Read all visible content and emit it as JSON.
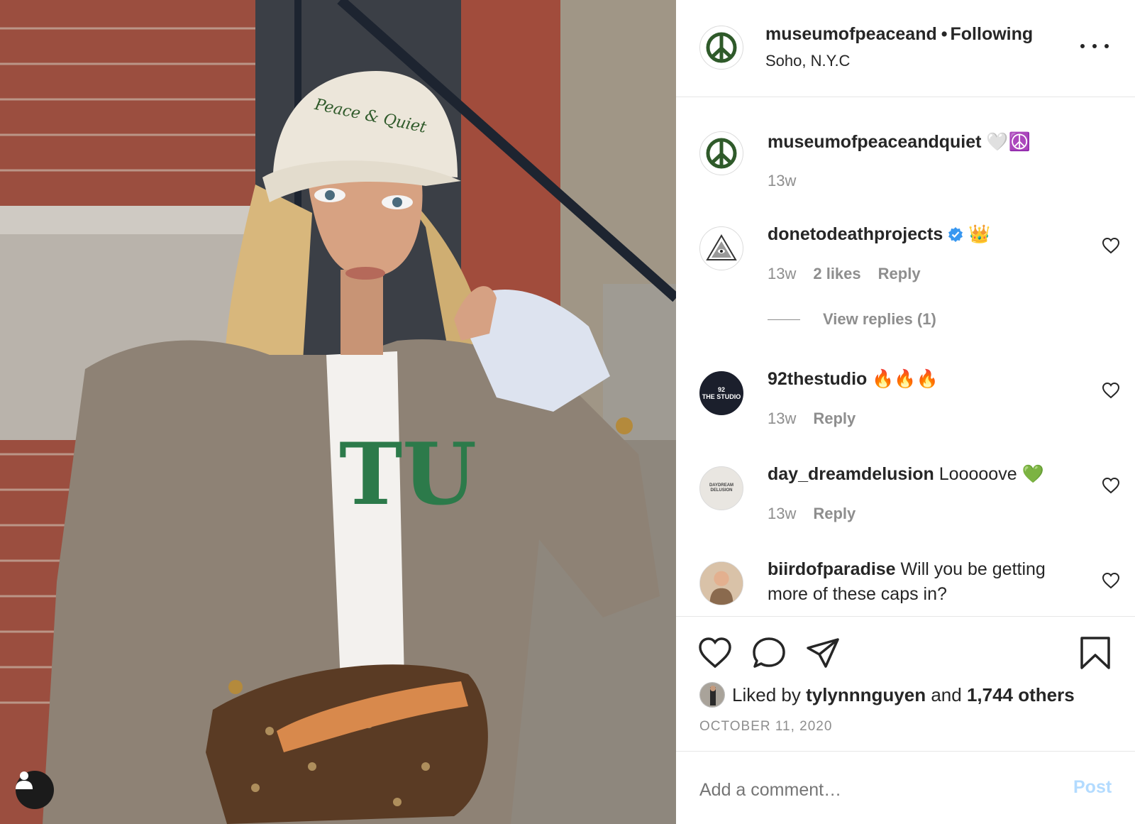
{
  "post": {
    "author": "museumofpeaceand⁠",
    "following_label": "Following",
    "location": "Soho, N.Y.C",
    "cap_text": "Peace & Quiet",
    "shirt_text": "TU"
  },
  "comments": [
    {
      "user": "museumofpeaceandquiet",
      "text": "🤍☮️",
      "time": "13w"
    },
    {
      "user": "donetodeathprojects",
      "text": "👑",
      "time": "13w",
      "likes": "2 likes",
      "reply": "Reply",
      "view_replies": "View replies (1)"
    },
    {
      "user": "92thestudio",
      "text": "🔥🔥🔥",
      "time": "13w",
      "reply": "Reply",
      "avatar_text": "92\nTHE STUDIO"
    },
    {
      "user": "day_dreamdelusion",
      "text": "Looooove 💚",
      "time": "13w",
      "reply": "Reply",
      "avatar_text": "DAYDREAM\nDELUSION"
    },
    {
      "user": "biirdofparadise",
      "text": "Will you be getting more of these caps in?"
    }
  ],
  "likes": {
    "prefix": "Liked by",
    "user": "tylynnnguyen",
    "and": "and",
    "others": "1,744 others"
  },
  "date": "OCTOBER 11, 2020",
  "add_comment": {
    "placeholder": "Add a comment…",
    "post_label": "Post"
  },
  "colors": {
    "peace_green": "#2f5a2a",
    "verified_blue": "#3897f0",
    "post_disabled": "#b3dbff"
  }
}
